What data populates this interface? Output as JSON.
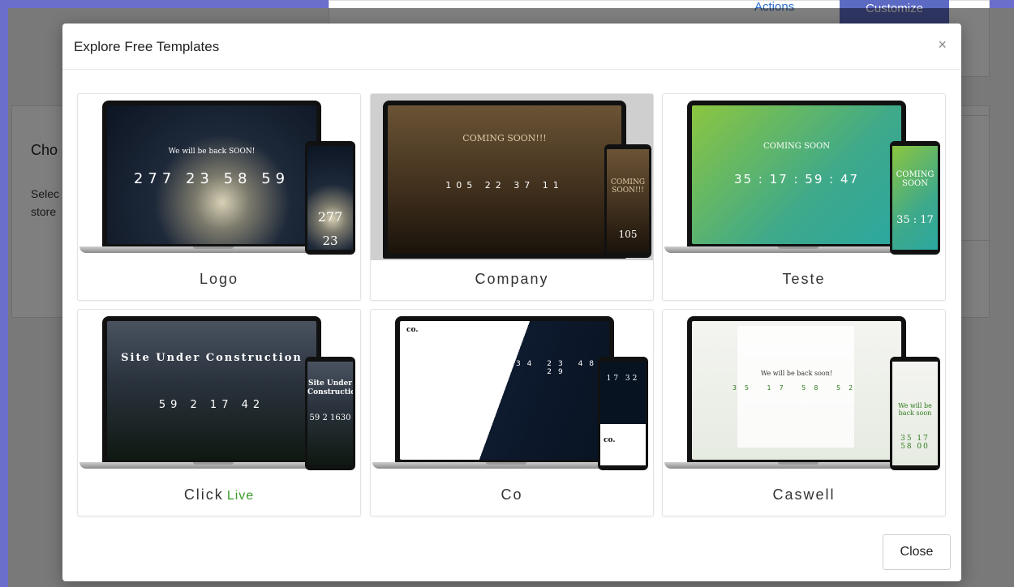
{
  "background": {
    "actions_label": "Actions",
    "customize_label": "Customize",
    "section_heading": "Cho",
    "section_text": "Selec store"
  },
  "modal": {
    "title": "Explore Free Templates",
    "close_icon": "close-icon",
    "close_button_label": "Close"
  },
  "templates": [
    {
      "label": "Logo",
      "badge": "",
      "preview": {
        "headline": "We will be back SOON!",
        "counter": "277 23 58 59",
        "phone_text": "277",
        "phone_counter": "23"
      }
    },
    {
      "label": "Company",
      "badge": "",
      "preview": {
        "headline": "COMING SOON!!!",
        "counter": "105 22 37 11",
        "phone_text": "COMING SOON!!!",
        "phone_counter": "105"
      }
    },
    {
      "label": "Teste",
      "badge": "",
      "preview": {
        "headline": "COMING SOON",
        "counter": "35 : 17 : 59 : 47",
        "phone_text": "COMING SOON",
        "phone_counter": "35 : 17"
      }
    },
    {
      "label": "Click",
      "badge": "Live",
      "preview": {
        "headline": "Site Under Construction",
        "counter": "59 2 17 42",
        "phone_text": "Site Under Construction",
        "phone_counter": "59 2 1630"
      }
    },
    {
      "label": "Co",
      "badge": "",
      "preview": {
        "headline": "co.",
        "counter": "34 23 48 29",
        "phone_text": "co.",
        "phone_counter": "17 32"
      }
    },
    {
      "label": "Caswell",
      "badge": "",
      "preview": {
        "headline": "We will be back soon!",
        "counter": "35 17 58 52",
        "phone_text": "We will be back soon",
        "phone_counter": "35 17 58 00"
      }
    }
  ],
  "colors": {
    "live_badge": "#3c9a2a",
    "accent_button": "#5c6ac4"
  }
}
